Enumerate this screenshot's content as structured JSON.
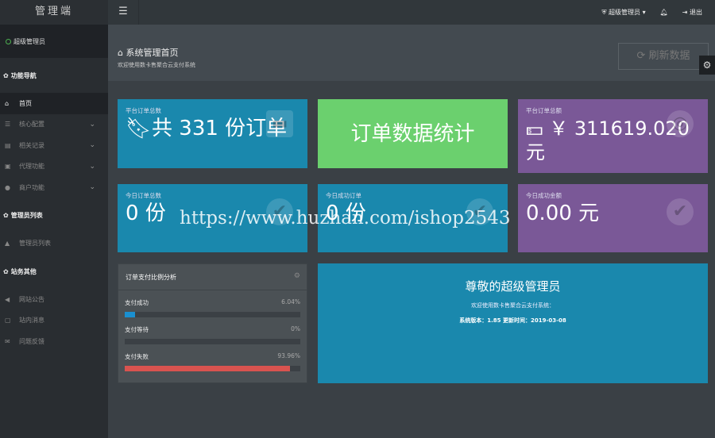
{
  "app": {
    "logo": "管理端"
  },
  "user": {
    "name": "超级管理员"
  },
  "sidebar": {
    "sections": [
      {
        "title": "功能导航"
      },
      {
        "title": "管理员列表"
      },
      {
        "title": "站务其他"
      }
    ],
    "nav": [
      {
        "label": "首页",
        "icon": "home"
      },
      {
        "label": "核心配置",
        "icon": "sliders"
      },
      {
        "label": "相关记录",
        "icon": "list"
      },
      {
        "label": "代理功能",
        "icon": "server"
      },
      {
        "label": "商户功能",
        "icon": "user"
      }
    ],
    "admin": [
      {
        "label": "管理员列表",
        "icon": "lock"
      }
    ],
    "other": [
      {
        "label": "网站公告",
        "icon": "volume"
      },
      {
        "label": "站内消息",
        "icon": "message"
      },
      {
        "label": "问题反馈",
        "icon": "envelope"
      }
    ]
  },
  "topbar": {
    "user": "超级管理员",
    "logout": "退出"
  },
  "header": {
    "title": "系统管理首页",
    "subtitle": "欢迎使用数卡售聚合云支付系统",
    "refresh": "刷新数据"
  },
  "cards": {
    "total_orders": {
      "label": "平台订单总数",
      "value": "共 331 份订单"
    },
    "stats_title": "订单数据统计",
    "total_amount": {
      "label": "平台订单总额",
      "value": "￥ 311619.020 元"
    },
    "today_orders": {
      "label": "今日订单总数",
      "value": "0 份"
    },
    "today_success": {
      "label": "今日成功订单",
      "value": "0 份"
    },
    "today_amount": {
      "label": "今日成功金额",
      "value": "0.00 元"
    }
  },
  "panel": {
    "title": "订单支付比例分析",
    "rows": [
      {
        "label": "支付成功",
        "pct": "6.04%",
        "value": 6.04,
        "color": "#1a8fd0"
      },
      {
        "label": "支付等待",
        "pct": "0%",
        "value": 0,
        "color": "#1a8fd0"
      },
      {
        "label": "支付失败",
        "pct": "93.96%",
        "value": 93.96,
        "color": "#d9534f"
      }
    ]
  },
  "welcome": {
    "title": "尊敬的超级管理员",
    "subtitle": "欢迎使用数卡售聚合云支付系统：",
    "version": "系统版本：1.85 更新时间：2019-03-08"
  },
  "watermark": "https://www.huzhan.com/ishop2543"
}
